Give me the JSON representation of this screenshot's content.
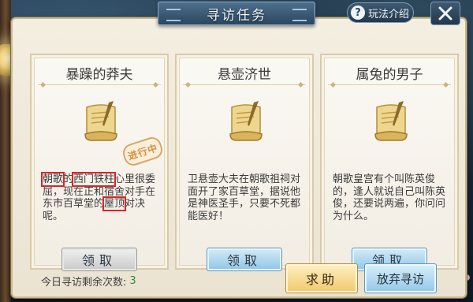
{
  "window": {
    "title": "寻访任务",
    "help_label": "玩法介绍",
    "help_icon": "question-icon",
    "close_icon": "close-icon"
  },
  "cards": [
    {
      "title": "暴躁的莽夫",
      "icon": "scroll-icon",
      "stamp": "进行中",
      "description": {
        "highlight_1": "朝歌",
        "part_1": "的",
        "highlight_2": "西门铁柱",
        "part_2": "心里很委屈，现在正和宿舍对手在东市百草堂的",
        "highlight_3": "屋顶",
        "part_3": "对决呢。"
      },
      "button": "领取",
      "button_style": "grey"
    },
    {
      "title": "悬壶济世",
      "icon": "scroll-icon",
      "description_text": "卫悬壶大夫在朝歌祖祠对面开了家百草堂，据说他是神医圣手，只要不死都能医好！",
      "button": "领取",
      "button_style": "blue"
    },
    {
      "title": "属兔的男子",
      "icon": "scroll-icon",
      "description_text": "朝歌皇宫有个叫陈英俊的，逢人就说自己叫陈英俊，还要说两遍，你问问为什么。",
      "button": "领取",
      "button_style": "blue"
    }
  ],
  "footer": {
    "remaining_label": "今日寻访剩余次数:",
    "remaining_count": "3",
    "help_button": "求助",
    "abandon_button": "放弃寻访"
  },
  "colors": {
    "panel_bg": "#f4eee1",
    "title_tab": "#2b4760",
    "highlight_box": "#e0232a",
    "count_green": "#2f8a3a",
    "help_button_gold": "#f0c96a",
    "action_blue": "#92c7e7"
  }
}
